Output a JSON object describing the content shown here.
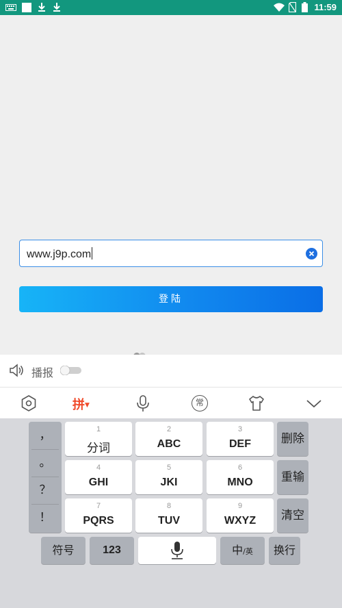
{
  "status_bar": {
    "time": "11:59",
    "left_icons": [
      "keyboard-icon",
      "square-notification-icon",
      "download-icon",
      "download-icon"
    ],
    "right_icons": [
      "wifi-icon",
      "no-sim-icon",
      "battery-icon"
    ]
  },
  "app": {
    "url_input": {
      "value": "www.j9p.com"
    },
    "login_button": {
      "label": "登陆"
    },
    "accent_color": "#1189ef"
  },
  "ime": {
    "broadcast": {
      "label": "播报",
      "enabled": false
    },
    "toolbar": {
      "pinyin_label": "拼",
      "icons": [
        "settings-hexagon-icon",
        "pinyin-mode",
        "microphone-icon",
        "common-phrases-icon",
        "skin-shirt-icon",
        "collapse-chevron-icon"
      ],
      "common_label": "常"
    },
    "side_symbols": [
      "，",
      "。",
      "？",
      "！"
    ],
    "keys": [
      {
        "num": "1",
        "label": "分词"
      },
      {
        "num": "2",
        "label": "ABC"
      },
      {
        "num": "3",
        "label": "DEF"
      },
      {
        "num": "4",
        "label": "GHI"
      },
      {
        "num": "5",
        "label": "JKI"
      },
      {
        "num": "6",
        "label": "MNO"
      },
      {
        "num": "7",
        "label": "PQRS"
      },
      {
        "num": "8",
        "label": "TUV"
      },
      {
        "num": "9",
        "label": "WXYZ"
      }
    ],
    "right_keys": {
      "delete": "删除",
      "retype": "重输",
      "clear": "清空"
    },
    "bottom_row": {
      "symbols": "符号",
      "numbers": "123",
      "lang_main": "中",
      "lang_sub": "/英",
      "newline": "换行"
    },
    "colors": {
      "pinyin": "#f04a2a",
      "keyboard_bg": "#d7d8dc",
      "function_key": "#adb1b8"
    }
  }
}
